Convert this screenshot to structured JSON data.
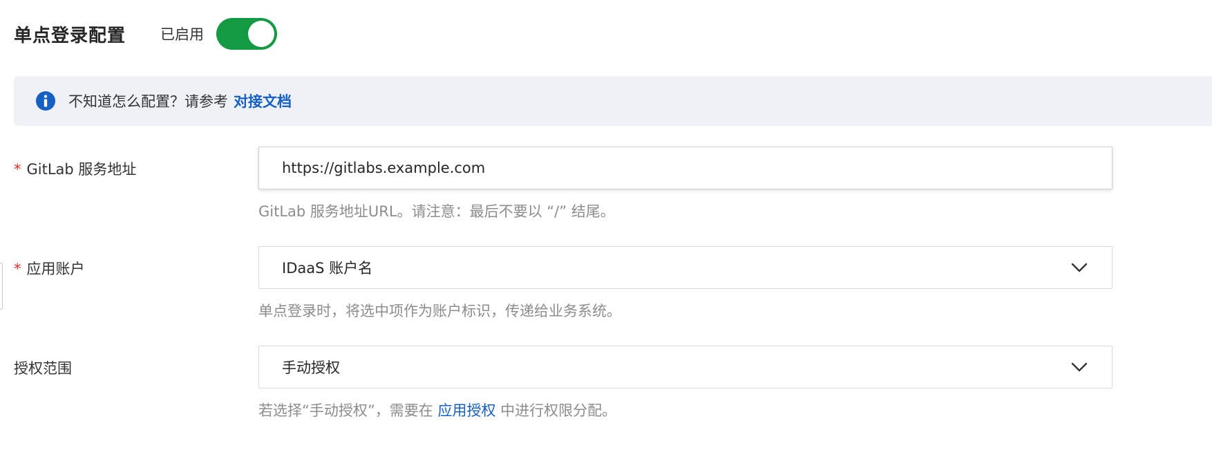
{
  "header": {
    "title": "单点登录配置",
    "status_label": "已启用",
    "toggle_enabled": true
  },
  "banner": {
    "text": "不知道怎么配置？请参考",
    "link": "对接文档",
    "icon": "info-icon"
  },
  "fields": {
    "gitlab_url": {
      "required_mark": "*",
      "label": "GitLab 服务地址",
      "value": "https://gitlabs.example.com",
      "help": "GitLab 服务地址URL。请注意：最后不要以 “/” 结尾。"
    },
    "app_account": {
      "required_mark": "*",
      "label": "应用账户",
      "value": "IDaaS 账户名",
      "help": "单点登录时，将选中项作为账户标识，传递给业务系统。"
    },
    "auth_scope": {
      "label": "授权范围",
      "value": "手动授权",
      "help_prefix": "若选择“手动授权”，需要在",
      "help_link": "应用授权",
      "help_suffix": "中进行权限分配。"
    }
  },
  "colors": {
    "accent_green": "#139a43",
    "link_blue": "#1660c4",
    "banner_bg": "#eef1f5",
    "required_red": "#d93026"
  }
}
